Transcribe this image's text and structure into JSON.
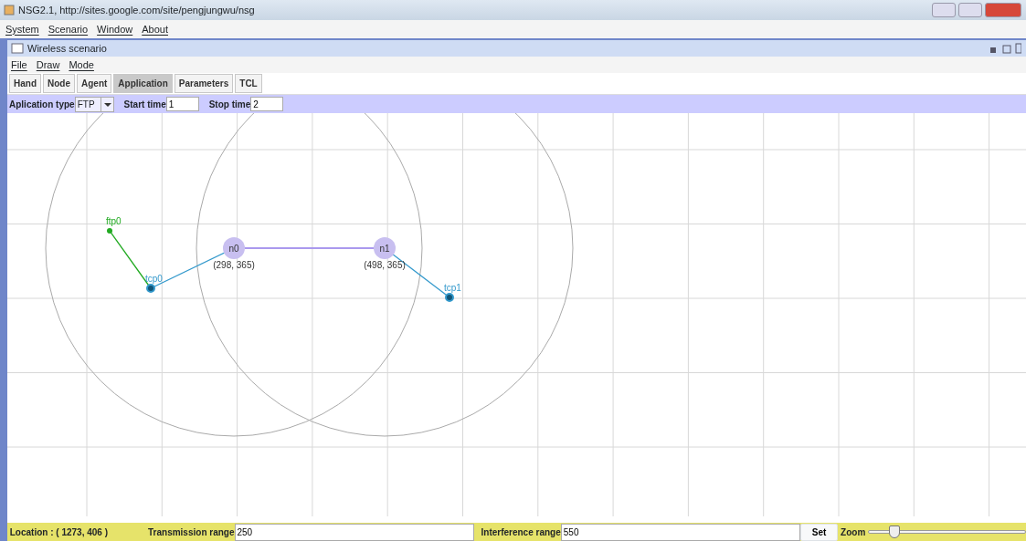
{
  "window": {
    "title": "NSG2.1, http://sites.google.com/site/pengjungwu/nsg"
  },
  "menu": [
    "System",
    "Scenario",
    "Window",
    "About"
  ],
  "internal_frame": {
    "title": "Wireless scenario",
    "menu": [
      "File",
      "Draw",
      "Mode"
    ]
  },
  "tabs": [
    {
      "label": "Hand",
      "selected": false
    },
    {
      "label": "Node",
      "selected": false
    },
    {
      "label": "Agent",
      "selected": false
    },
    {
      "label": "Application",
      "selected": true
    },
    {
      "label": "Parameters",
      "selected": false
    },
    {
      "label": "TCL",
      "selected": false
    }
  ],
  "params": {
    "type_label": "Aplication type",
    "type_value": "FTP",
    "start_label": "Start time",
    "start_value": "1",
    "stop_label": "Stop time",
    "stop_value": "2"
  },
  "nodes": [
    {
      "label": "n0",
      "coords": "(298, 365)"
    },
    {
      "label": "n1",
      "coords": "(498, 365)"
    }
  ],
  "agents": [
    {
      "label": "ftp0",
      "color": "#22aa22",
      "kind": "app"
    },
    {
      "label": "tcp0",
      "color": "#3399cc",
      "kind": "transport"
    },
    {
      "label": "tcp1",
      "color": "#3399cc",
      "kind": "transport"
    }
  ],
  "status": {
    "location": "Location : ( 1273, 406 )",
    "tx_label": "Transmission range",
    "tx_value": "250",
    "if_label": "Interference range",
    "if_value": "550",
    "set": "Set",
    "zoom_label": "Zoom",
    "zoom": {
      "level": 0.17
    }
  }
}
